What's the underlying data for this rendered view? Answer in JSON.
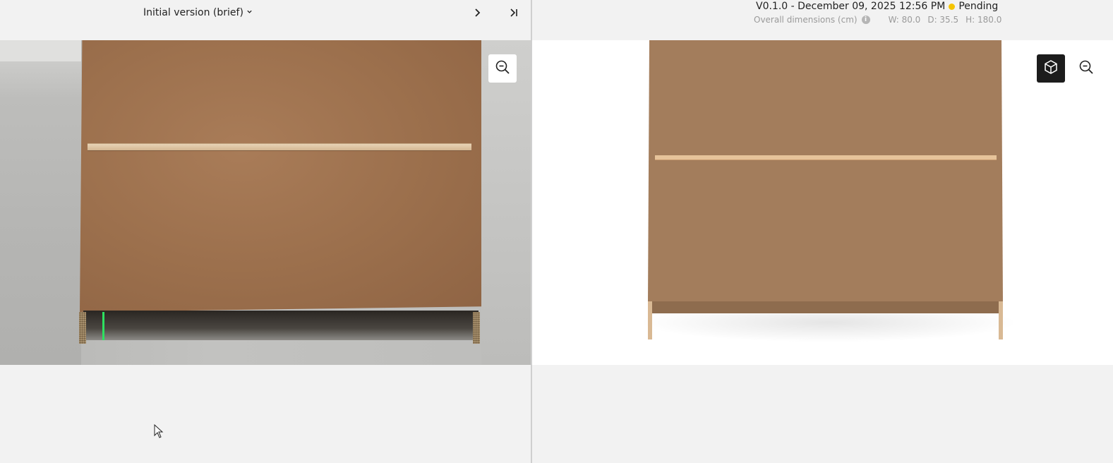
{
  "left": {
    "version_label": "Initial version (brief)",
    "icons": {
      "dropdown": "chevron-down-icon",
      "next": "chevron-right-icon",
      "last": "skip-to-end-icon",
      "zoom": "zoom-out-icon"
    }
  },
  "right": {
    "version_info": "V0.1.0 - December 09, 2025 12:56 PM",
    "status": "Pending",
    "status_color": "#f5c400",
    "dimensions_label": "Overall dimensions (cm)",
    "width": "W: 80.0",
    "depth": "D: 35.5",
    "height": "H: 180.0",
    "icons": {
      "info": "info-icon",
      "view3d": "cube-icon",
      "zoom": "zoom-out-icon"
    }
  }
}
